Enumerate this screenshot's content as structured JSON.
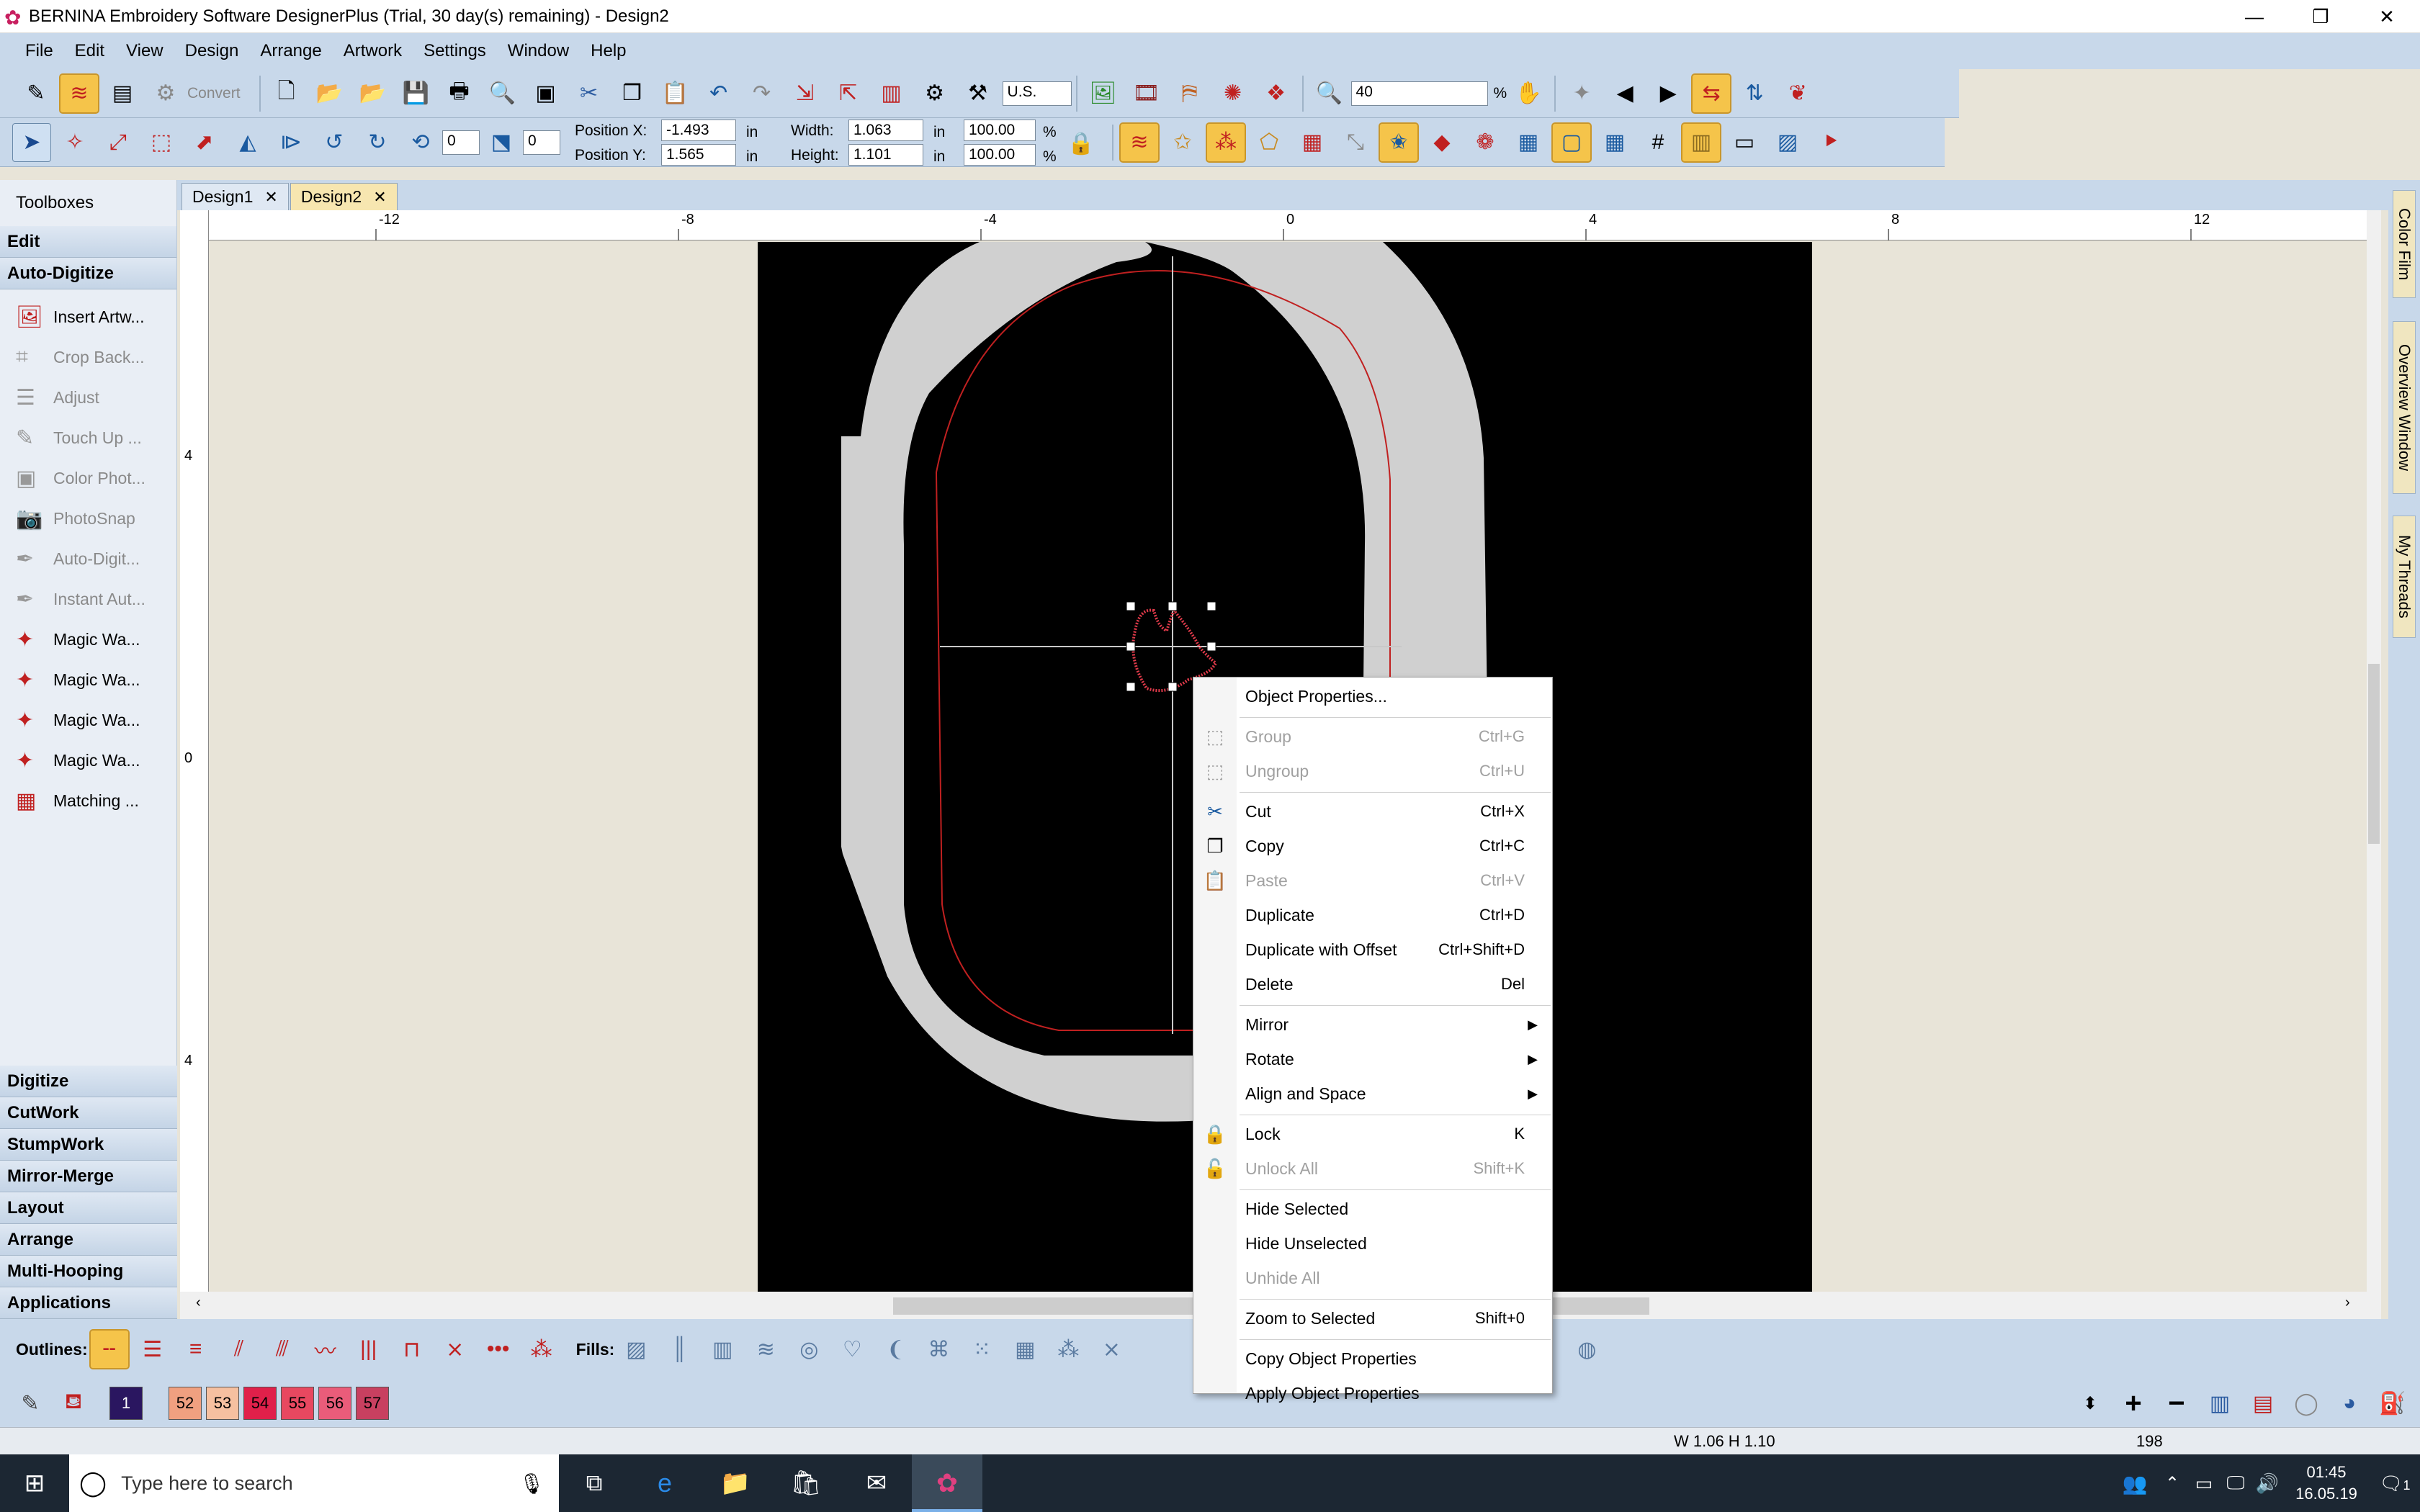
{
  "window": {
    "title": "BERNINA Embroidery Software DesignerPlus (Trial, 30 day(s) remaining) - Design2",
    "minimize": "—",
    "restore": "❐",
    "close": "✕"
  },
  "menu": [
    "File",
    "Edit",
    "View",
    "Design",
    "Arrange",
    "Artwork",
    "Settings",
    "Window",
    "Help"
  ],
  "toolbar1": {
    "convert": "Convert",
    "units": "U.S.",
    "zoom": "40",
    "zoom_unit": "%"
  },
  "toolbar2": {
    "angle1": "0",
    "angle2": "0",
    "pos_x_label": "Position X:",
    "pos_x": "-1.493",
    "pos_y_label": "Position Y:",
    "pos_y": "1.565",
    "width_label": "Width:",
    "width": "1.063",
    "height_label": "Height:",
    "height": "1.101",
    "unit": "in",
    "scale_w": "100.00",
    "scale_h": "100.00",
    "pct": "%"
  },
  "sidebar": {
    "title": "Toolboxes",
    "edit": "Edit",
    "autodigitize": "Auto-Digitize",
    "tools": [
      {
        "label": "Insert Artw...",
        "icon": "insert-artwork-icon",
        "disabled": false
      },
      {
        "label": "Crop Back...",
        "icon": "crop-icon",
        "disabled": true
      },
      {
        "label": "Adjust",
        "icon": "adjust-icon",
        "disabled": true
      },
      {
        "label": "Touch Up ...",
        "icon": "touch-up-icon",
        "disabled": true
      },
      {
        "label": "Color Phot...",
        "icon": "color-photo-icon",
        "disabled": true
      },
      {
        "label": "PhotoSnap",
        "icon": "camera-icon",
        "disabled": true
      },
      {
        "label": "Auto-Digit...",
        "icon": "auto-digitize-icon",
        "disabled": true
      },
      {
        "label": "Instant Aut...",
        "icon": "instant-auto-icon",
        "disabled": true
      },
      {
        "label": "Magic Wa...",
        "icon": "magic-wand-icon",
        "disabled": false
      },
      {
        "label": "Magic Wa...",
        "icon": "magic-wand-icon",
        "disabled": false
      },
      {
        "label": "Magic Wa...",
        "icon": "magic-wand-icon",
        "disabled": false
      },
      {
        "label": "Magic Wa...",
        "icon": "magic-wand-icon",
        "disabled": false
      },
      {
        "label": "Matching ...",
        "icon": "matching-icon",
        "disabled": false
      }
    ],
    "groups": [
      "Digitize",
      "CutWork",
      "StumpWork",
      "Mirror-Merge",
      "Layout",
      "Arrange",
      "Multi-Hooping",
      "Applications"
    ]
  },
  "tabs": [
    {
      "label": "Design1",
      "close": "✕"
    },
    {
      "label": "Design2",
      "close": "✕"
    }
  ],
  "ruler": {
    "h": [
      "-12",
      "-8",
      "-4",
      "0",
      "4",
      "8",
      "12"
    ],
    "v": [
      "4",
      "0",
      "4"
    ]
  },
  "right_tabs": [
    "Color Film",
    "Overview Window",
    "My Threads"
  ],
  "bottom": {
    "outlines": "Outlines:",
    "fills": "Fills:"
  },
  "colors": [
    {
      "num": "1",
      "hex": "#2a1660"
    },
    {
      "num": "52",
      "hex": "#f0a080"
    },
    {
      "num": "53",
      "hex": "#f6c0a0"
    },
    {
      "num": "54",
      "hex": "#e0204a"
    },
    {
      "num": "55",
      "hex": "#e84860"
    },
    {
      "num": "56",
      "hex": "#ea5c7a"
    },
    {
      "num": "57",
      "hex": "#c84060"
    }
  ],
  "status": {
    "dims": "W 1.06 H 1.10",
    "count": "198"
  },
  "taskbar": {
    "search": "Type here to search",
    "time": "01:45",
    "date": "16.05.19",
    "notif": "1"
  },
  "context_menu": [
    {
      "label": "Object Properties...",
      "shortcut": "",
      "disabled": false,
      "icon": ""
    },
    {
      "sep": true
    },
    {
      "label": "Group",
      "shortcut": "Ctrl+G",
      "disabled": true,
      "icon": "group-icon"
    },
    {
      "label": "Ungroup",
      "shortcut": "Ctrl+U",
      "disabled": true,
      "icon": "ungroup-icon"
    },
    {
      "sep": true
    },
    {
      "label": "Cut",
      "shortcut": "Ctrl+X",
      "disabled": false,
      "icon": "scissors-icon"
    },
    {
      "label": "Copy",
      "shortcut": "Ctrl+C",
      "disabled": false,
      "icon": "copy-icon"
    },
    {
      "label": "Paste",
      "shortcut": "Ctrl+V",
      "disabled": true,
      "icon": "paste-icon"
    },
    {
      "label": "Duplicate",
      "shortcut": "Ctrl+D",
      "disabled": false,
      "icon": ""
    },
    {
      "label": "Duplicate with Offset",
      "shortcut": "Ctrl+Shift+D",
      "disabled": false,
      "icon": ""
    },
    {
      "label": "Delete",
      "shortcut": "Del",
      "disabled": false,
      "icon": ""
    },
    {
      "sep": true
    },
    {
      "label": "Mirror",
      "shortcut": "",
      "disabled": false,
      "icon": "",
      "sub": true
    },
    {
      "label": "Rotate",
      "shortcut": "",
      "disabled": false,
      "icon": "",
      "sub": true
    },
    {
      "label": "Align and Space",
      "shortcut": "",
      "disabled": false,
      "icon": "",
      "sub": true
    },
    {
      "sep": true
    },
    {
      "label": "Lock",
      "shortcut": "K",
      "disabled": false,
      "icon": "lock-icon"
    },
    {
      "label": "Unlock All",
      "shortcut": "Shift+K",
      "disabled": true,
      "icon": "unlock-icon"
    },
    {
      "sep": true
    },
    {
      "label": "Hide Selected",
      "shortcut": "",
      "disabled": false,
      "icon": ""
    },
    {
      "label": "Hide Unselected",
      "shortcut": "",
      "disabled": false,
      "icon": ""
    },
    {
      "label": "Unhide All",
      "shortcut": "",
      "disabled": true,
      "icon": ""
    },
    {
      "sep": true
    },
    {
      "label": "Zoom to Selected",
      "shortcut": "Shift+0",
      "disabled": false,
      "icon": ""
    },
    {
      "sep": true
    },
    {
      "label": "Copy Object Properties",
      "shortcut": "",
      "disabled": false,
      "icon": ""
    },
    {
      "label": "Apply Object Properties",
      "shortcut": "",
      "disabled": false,
      "icon": ""
    }
  ]
}
